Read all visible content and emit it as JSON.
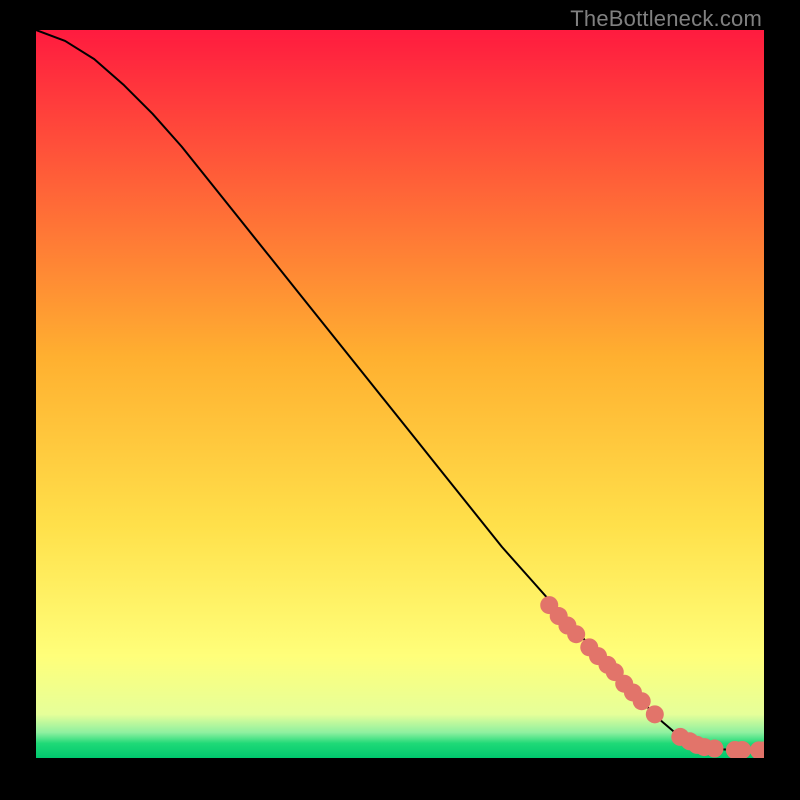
{
  "watermark": "TheBottleneck.com",
  "chart_data": {
    "type": "line",
    "title": "",
    "xlabel": "",
    "ylabel": "",
    "xlim": [
      0,
      100
    ],
    "ylim": [
      0,
      100
    ],
    "grid": false,
    "legend": false,
    "background_gradient": {
      "top_color": "#ff1b3f",
      "mid_color": "#ffd340",
      "low_color": "#ffff8a",
      "bottom_color": "#00e37a"
    },
    "series": [
      {
        "name": "curve",
        "style": "line",
        "color": "#000000",
        "x": [
          0,
          4,
          8,
          12,
          16,
          20,
          24,
          28,
          32,
          36,
          40,
          44,
          48,
          52,
          56,
          60,
          64,
          68,
          72,
          76,
          80,
          84,
          86,
          88,
          90,
          92,
          94,
          96,
          98,
          100
        ],
        "y": [
          100,
          98.5,
          96,
          92.5,
          88.5,
          84,
          79,
          74,
          69,
          64,
          59,
          54,
          49,
          44,
          39,
          34,
          29,
          24.5,
          20,
          15.5,
          11,
          7,
          5,
          3.3,
          2.2,
          1.5,
          1.2,
          1.1,
          1.05,
          1.0
        ]
      },
      {
        "name": "highlighted-points",
        "style": "scatter",
        "color": "#e2746a",
        "radius": 9,
        "x": [
          70.5,
          71.8,
          73.0,
          74.2,
          76.0,
          77.2,
          78.5,
          79.5,
          80.8,
          82.0,
          83.2,
          85.0,
          88.5,
          89.8,
          90.8,
          91.8,
          93.2,
          96.0,
          97.0,
          99.3,
          100.0
        ],
        "y": [
          21.0,
          19.5,
          18.2,
          17.0,
          15.2,
          14.0,
          12.8,
          11.8,
          10.2,
          9.0,
          7.8,
          6.0,
          2.9,
          2.3,
          1.8,
          1.5,
          1.3,
          1.1,
          1.1,
          1.05,
          1.05
        ]
      }
    ]
  }
}
